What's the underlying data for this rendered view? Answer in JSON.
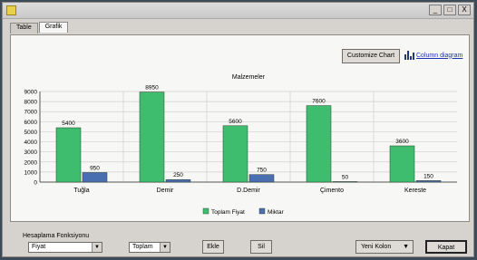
{
  "window": {
    "minimize": "_",
    "maximize": "□",
    "close": "X"
  },
  "tabs": [
    {
      "label": "Table"
    },
    {
      "label": "Grafik"
    }
  ],
  "toolbar": {
    "customize_label": "Customize Chart",
    "chart_type_label": "Column diagram",
    "chart_type_icon": "bar-chart-icon"
  },
  "chart_data": {
    "type": "bar",
    "title": "Malzemeler",
    "categories": [
      "Tuğla",
      "Demir",
      "D.Demir",
      "Çimento",
      "Kereste"
    ],
    "series": [
      {
        "name": "Toplam Fiyat",
        "color": "#3fbd6e",
        "values": [
          5400,
          8950,
          5600,
          7600,
          3600
        ]
      },
      {
        "name": "Miktar",
        "color": "#4a6fb0",
        "values": [
          950,
          250,
          750,
          50,
          150
        ]
      }
    ],
    "data_labels": [
      [
        "5400",
        "950"
      ],
      [
        "8950",
        "250"
      ],
      [
        "5600",
        "750"
      ],
      [
        "7600",
        "50"
      ],
      [
        "3600",
        "150"
      ]
    ],
    "yticks": [
      0,
      1000,
      2000,
      3000,
      4000,
      5000,
      6000,
      7000,
      8000,
      9000
    ],
    "ylim": [
      0,
      9000
    ],
    "grid": true,
    "legend_position": "bottom"
  },
  "bottom": {
    "label": "Hesaplama Fonksiyonu",
    "field_select": "Fiyat",
    "func_select": "Toplam",
    "btn1": "Ekle",
    "btn2": "Sil",
    "new_column": "Yeni Kolon",
    "close_button": "Kapat"
  }
}
